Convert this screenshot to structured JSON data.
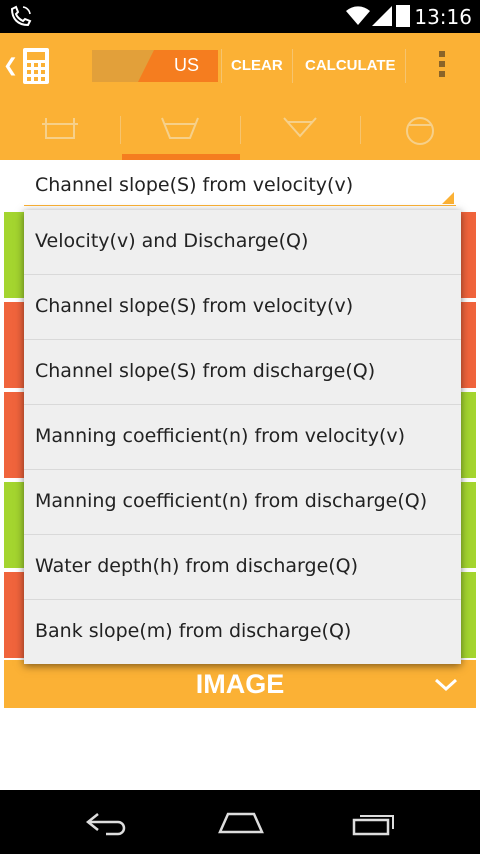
{
  "status_bar": {
    "time": "13:16"
  },
  "action_bar": {
    "unit_selected": "US",
    "clear_label": "CLEAR",
    "calculate_label": "CALCULATE"
  },
  "channel_shapes": [
    {
      "icon": "rectangular-channel-icon",
      "active": false
    },
    {
      "icon": "trapezoidal-channel-icon",
      "active": true
    },
    {
      "icon": "triangular-channel-icon",
      "active": false
    },
    {
      "icon": "circular-channel-icon",
      "active": false
    }
  ],
  "calculation_spinner": {
    "selected": "Channel slope(S) from velocity(v)"
  },
  "dropdown": {
    "options": [
      "Velocity(v) and Discharge(Q)",
      "Channel slope(S) from velocity(v)",
      "Channel slope(S) from discharge(Q)",
      "Manning coefficient(n) from velocity(v)",
      "Manning coefficient(n) from discharge(Q)",
      "Water depth(h) from discharge(Q)",
      "Bank slope(m) from discharge(Q)"
    ]
  },
  "image_section": {
    "label": "IMAGE"
  },
  "colors": {
    "accent": "#fbb135",
    "accent_dark": "#f57d1f",
    "input_row_green": "#a4d52f",
    "output_row_red": "#f0643c"
  }
}
